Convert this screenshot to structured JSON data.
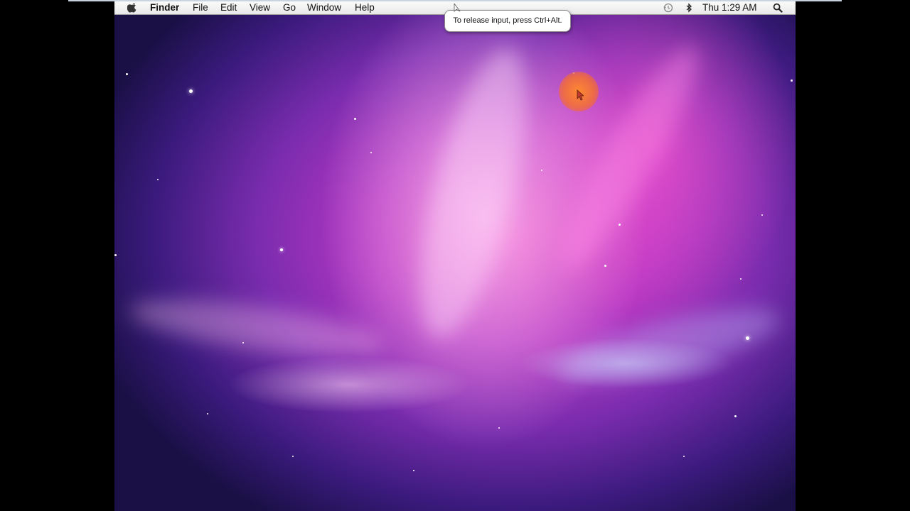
{
  "menubar": {
    "app_name": "Finder",
    "menus": [
      "File",
      "Edit",
      "View",
      "Go",
      "Window",
      "Help"
    ],
    "clock": "Thu 1:29 AM",
    "icons": [
      "apple-icon",
      "time-machine-icon",
      "bluetooth-icon",
      "spotlight-search-icon"
    ]
  },
  "tooltip": {
    "text": "To release input, press Ctrl+Alt."
  },
  "colors": {
    "menubar_bg": "#f2f2f2",
    "wallpaper_core": "#e03fbf",
    "wallpaper_edge": "#1a1046",
    "click_highlight": "#f58a32"
  }
}
